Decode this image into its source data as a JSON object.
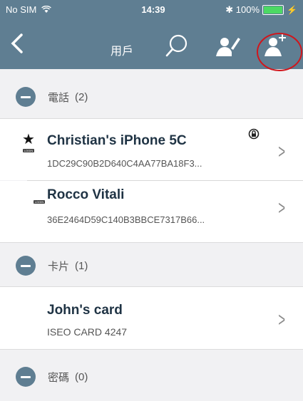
{
  "status": {
    "carrier": "No SIM",
    "time": "14:39",
    "bt_battery": "✱ 100%"
  },
  "nav": {
    "title": "用戶"
  },
  "sections": [
    {
      "label": "電話",
      "count": "(2)"
    },
    {
      "label": "卡片",
      "count": "(1)"
    },
    {
      "label": "密碼",
      "count": "(0)"
    }
  ],
  "devices": [
    {
      "name": "Christian's iPhone 5C",
      "id": "1DC29C90B2D640C4AA77BA18F3...",
      "tag": "LOGIN"
    },
    {
      "name": "Rocco Vitali",
      "id": "36E2464D59C140B3BBCE7317B66...",
      "tag": "LOGIN"
    }
  ],
  "cards": [
    {
      "name": "John's card",
      "id": "ISEO CARD 4247"
    }
  ],
  "colors": {
    "accent": "#5f7e92",
    "highlight": "#d0161c"
  }
}
